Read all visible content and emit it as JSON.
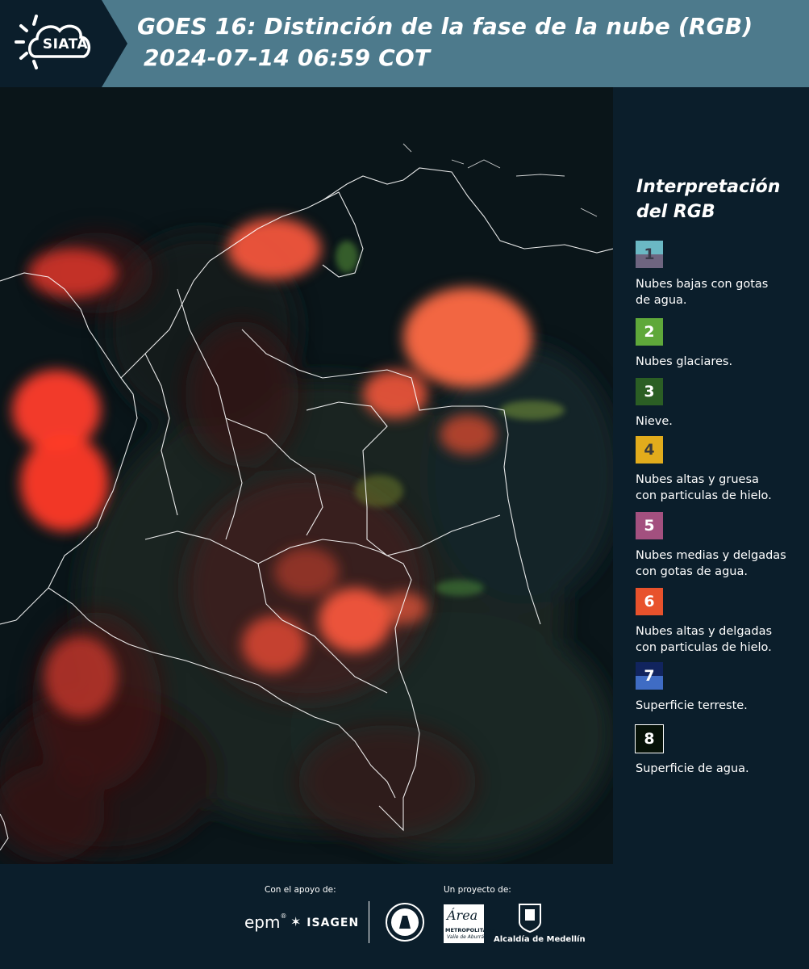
{
  "header": {
    "logo_text": "SIATA",
    "title_line1": "GOES 16: Distinción de la fase de la nube (RGB)",
    "title_line2": "2024-07-14 06:59 COT"
  },
  "legend": {
    "title_line1": "Interpretación",
    "title_line2": "del RGB",
    "items": [
      {
        "num": "1",
        "label_line1": "Nubes bajas con gotas",
        "label_line2": "de agua.",
        "color_top": "#6bb8c4",
        "color_bottom": "#6e6580",
        "text_color": "#3a3a4a"
      },
      {
        "num": "2",
        "label_line1": "Nubes glaciares.",
        "label_line2": "",
        "color_top": "#5fa83a",
        "color_bottom": "#5fa83a",
        "text_color": "#ffffff"
      },
      {
        "num": "3",
        "label_line1": "Nieve.",
        "label_line2": "",
        "color_top": "#2b5e24",
        "color_bottom": "#2b5e24",
        "text_color": "#ffffff"
      },
      {
        "num": "4",
        "label_line1": "Nubes altas y gruesa",
        "label_line2": "con particulas de hielo.",
        "color_top": "#e2ac1c",
        "color_bottom": "#e2ac1c",
        "text_color": "#3a3a3a"
      },
      {
        "num": "5",
        "label_line1": "Nubes medias y delgadas",
        "label_line2": "con gotas de agua.",
        "color_top": "#a3507f",
        "color_bottom": "#a3507f",
        "text_color": "#ffffff"
      },
      {
        "num": "6",
        "label_line1": "Nubes altas y delgadas",
        "label_line2": "con particulas de hielo.",
        "color_top": "#e8522c",
        "color_bottom": "#e8522c",
        "text_color": "#ffffff"
      },
      {
        "num": "7",
        "label_line1": "Superficie terreste.",
        "label_line2": "",
        "color_top": "#11245e",
        "color_bottom": "#3f6cc4",
        "text_color": "#ffffff"
      },
      {
        "num": "8",
        "label_line1": "Superficie de agua.",
        "label_line2": "",
        "color_top": "#071208",
        "color_bottom": "#071208",
        "text_color": "#ffffff"
      }
    ]
  },
  "footer": {
    "support_caption": "Con el apoyo de:",
    "project_caption": "Un proyecto de:",
    "brand_epm": "epm",
    "brand_isagen": "ISAGEN",
    "brand_area_line1": "METROPOLITANA",
    "brand_area_line2": "Valle de Aburrá",
    "brand_area_script": "Área",
    "brand_alcaldia": "Alcaldía de Medellín"
  },
  "colors": {
    "header_bg": "#4d7a8c",
    "logo_bg": "#0b1e2b",
    "panel_bg": "#0b1e2b",
    "cloud_red": "#e8432a"
  }
}
